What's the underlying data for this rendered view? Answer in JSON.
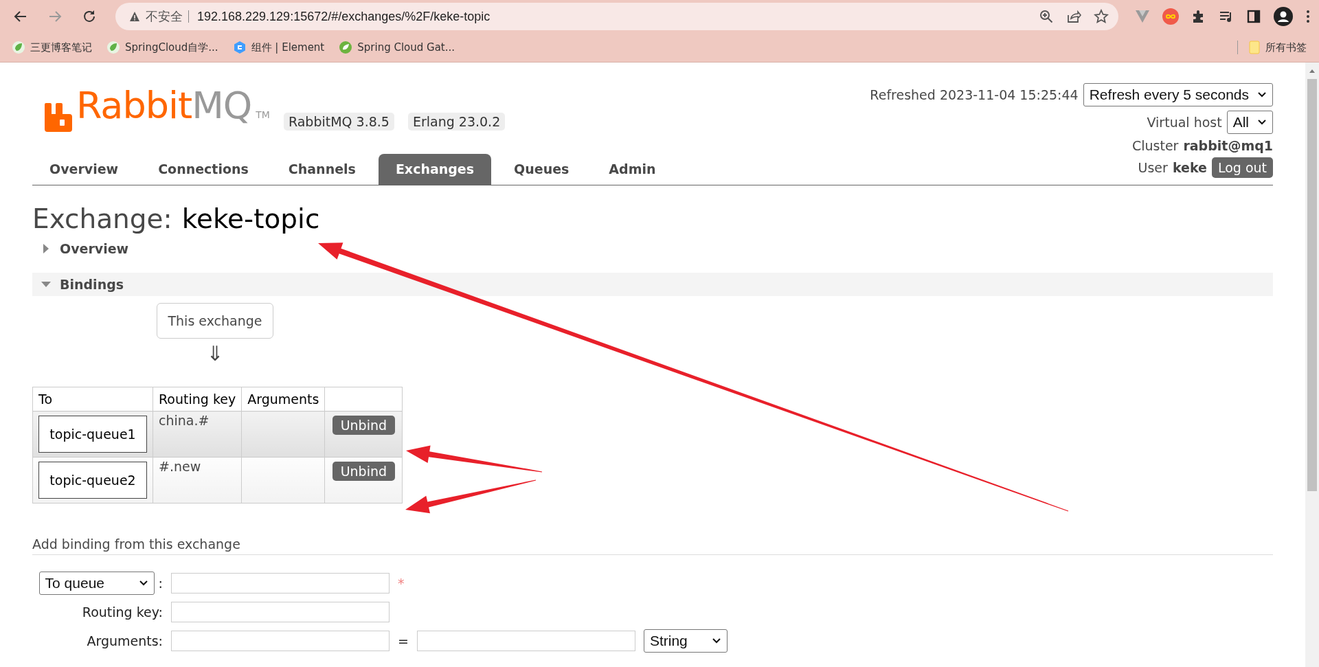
{
  "browser": {
    "nav": [
      {
        "kind": "back",
        "disabled": false
      },
      {
        "kind": "forward",
        "disabled": true
      },
      {
        "kind": "reload",
        "disabled": false
      }
    ],
    "security": "不安全",
    "url": "192.168.229.129:15672/#/exchanges/%2F/keke-topic",
    "bookmarks": [
      {
        "label": "三更博客笔记",
        "kind": "leaf"
      },
      {
        "label": "SpringCloud自学...",
        "kind": "leaf"
      },
      {
        "label": "组件 | Element",
        "kind": "hex"
      },
      {
        "label": "Spring Cloud Gat...",
        "kind": "spring"
      }
    ],
    "all_bookmarks": "所有书签"
  },
  "header": {
    "logo": {
      "orange": "Rabbit",
      "grey": "MQ",
      "mark": "TM"
    },
    "versions": [
      "RabbitMQ 3.8.5",
      "Erlang 23.0.2"
    ],
    "refreshed": "Refreshed 2023-11-04 15:25:44",
    "refresh_select": "Refresh every 5 seconds",
    "vhost_label": "Virtual host",
    "vhost_select": "All",
    "cluster_label": "Cluster",
    "cluster": "rabbit@mq1",
    "user_label": "User",
    "user": "keke",
    "logout": "Log out"
  },
  "tabs": [
    {
      "label": "Overview",
      "selected": false
    },
    {
      "label": "Connections",
      "selected": false
    },
    {
      "label": "Channels",
      "selected": false
    },
    {
      "label": "Exchanges",
      "selected": true
    },
    {
      "label": "Queues",
      "selected": false
    },
    {
      "label": "Admin",
      "selected": false
    }
  ],
  "title": {
    "label": "Exchange:",
    "name": "keke-topic"
  },
  "sections": [
    {
      "title": "Overview",
      "expanded": false
    },
    {
      "title": "Bindings",
      "expanded": true
    }
  ],
  "bindings": {
    "source": "This exchange",
    "arrow": "⇓",
    "columns": [
      "To",
      "Routing key",
      "Arguments"
    ],
    "rows": [
      {
        "to": "topic-queue1",
        "routing_key": "china.#",
        "action": "Unbind",
        "highlighted": true
      },
      {
        "to": "topic-queue2",
        "routing_key": "#.new",
        "action": "Unbind",
        "highlighted": false
      }
    ]
  },
  "add_binding": {
    "heading": "Add binding from this exchange",
    "destination": "To queue",
    "colon": ":",
    "required": "*",
    "routing_key_label": "Routing key:",
    "arguments_label": "Arguments:",
    "equals": "=",
    "type": "String"
  }
}
